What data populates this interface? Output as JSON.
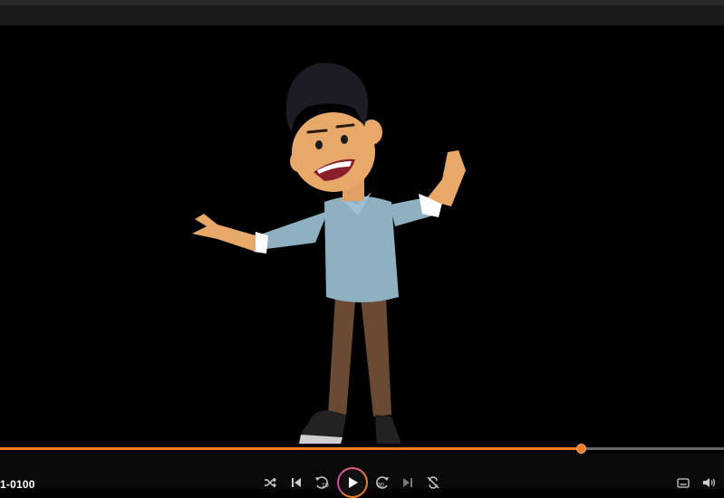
{
  "player": {
    "time_label": "1-0100",
    "progress_fraction": 0.804,
    "accent_color": "#f07c23",
    "play_state": "paused"
  },
  "controls": {
    "left": [
      "shuffle-icon",
      "previous-icon",
      "replay-10-icon"
    ],
    "center": "play-icon",
    "right": [
      "forward-30-icon",
      "next-icon",
      "repeat-icon"
    ],
    "far_right": [
      "subtitles-icon",
      "volume-icon"
    ],
    "replay_seconds": "10",
    "forward_seconds": "30"
  }
}
